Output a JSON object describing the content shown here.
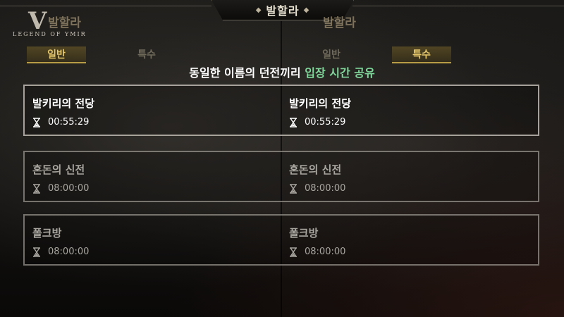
{
  "header": {
    "title": "발할라",
    "logo_text": "LEGEND OF YMIR",
    "logo_letter": "V"
  },
  "tabs": [
    {
      "label": "일반",
      "active": true
    },
    {
      "label": "특수",
      "active": false
    }
  ],
  "subtitle": {
    "prefix": "동일한 이름의 던전끼리",
    "accent": "입장 시간 공유"
  },
  "dungeons": [
    {
      "name": "발키리의 전당",
      "time": "00:55:29",
      "active": true
    },
    {
      "name": "혼돈의 신전",
      "time": "08:00:00",
      "active": false
    },
    {
      "name": "폴크방",
      "time": "08:00:00",
      "active": false
    }
  ],
  "colors": {
    "accent_green": "#7fd89a",
    "tab_gold": "#e5c76a",
    "card_border": "#bebab2"
  },
  "icons": {
    "timer": "hourglass-icon"
  }
}
